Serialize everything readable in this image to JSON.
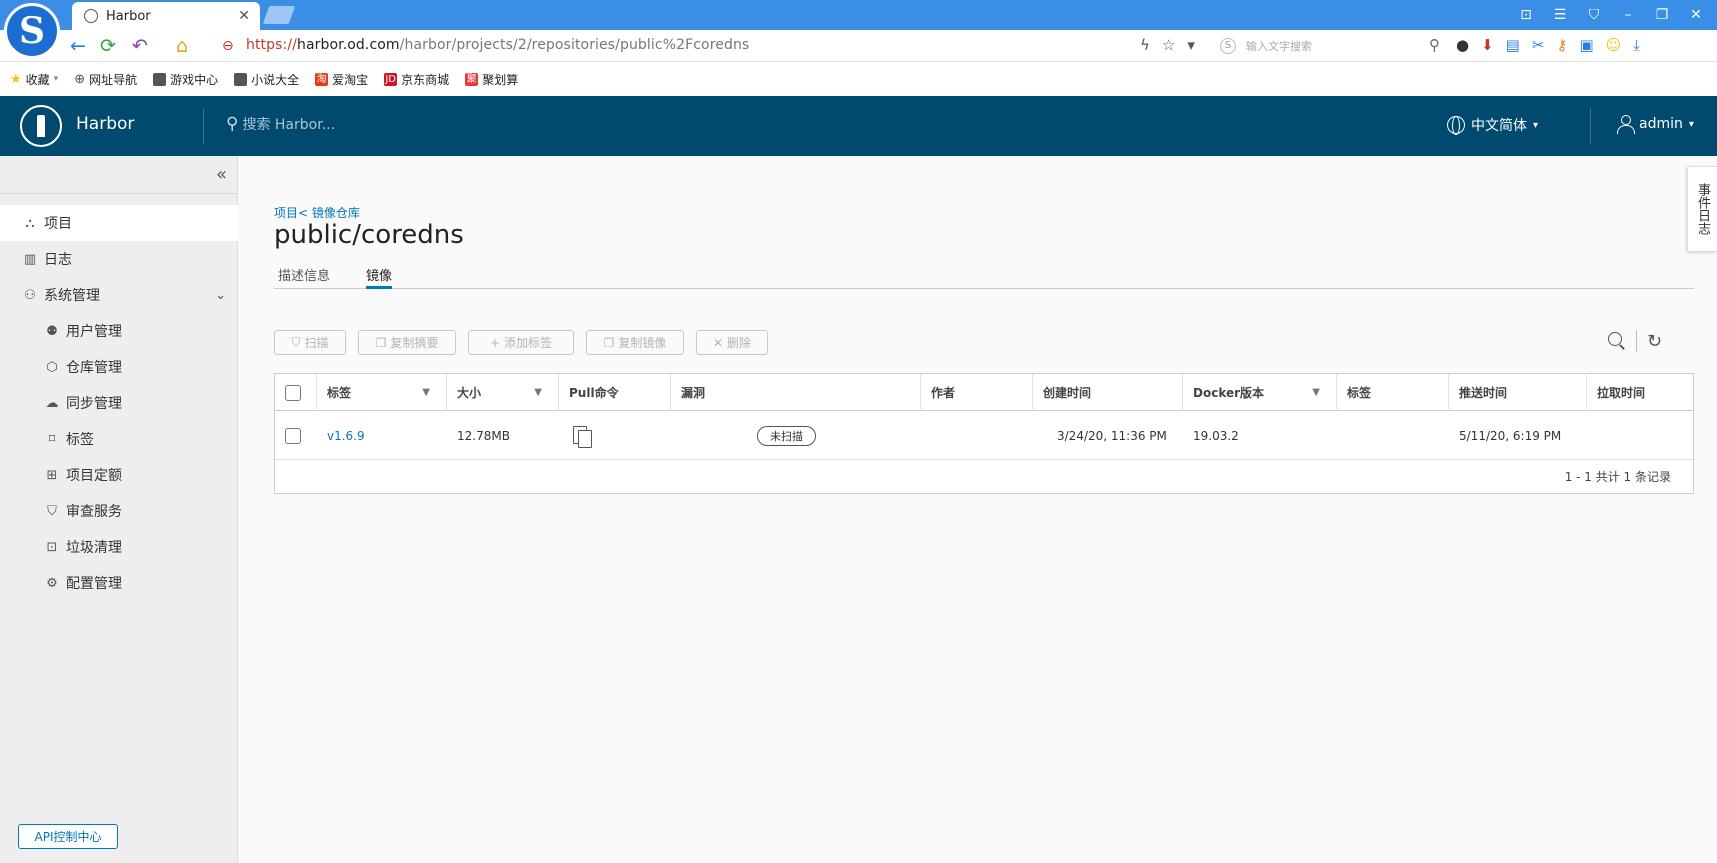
{
  "browser": {
    "tab_title": "Harbor",
    "url_proto": "https://",
    "url_host": "harbor.od.com",
    "url_path": "/harbor/projects/2/repositories/public%2Fcoredns",
    "search_placeholder": "输入文字搜索",
    "bookmarks": [
      "收藏",
      "网址导航",
      "游戏中心",
      "小说大全",
      "爱淘宝",
      "京东商城",
      "聚划算"
    ]
  },
  "header": {
    "app_name": "Harbor",
    "search_placeholder": "搜索 Harbor...",
    "language": "中文简体",
    "user": "admin"
  },
  "sidebar": {
    "items": [
      {
        "label": "项目",
        "icon": "projects-icon"
      },
      {
        "label": "日志",
        "icon": "log-icon"
      },
      {
        "label": "系统管理",
        "icon": "admin-icon"
      },
      {
        "label": "用户管理",
        "icon": "users-icon"
      },
      {
        "label": "仓库管理",
        "icon": "registry-icon"
      },
      {
        "label": "同步管理",
        "icon": "replication-icon"
      },
      {
        "label": "标签",
        "icon": "tag-icon"
      },
      {
        "label": "项目定额",
        "icon": "quota-icon"
      },
      {
        "label": "审查服务",
        "icon": "shield-icon"
      },
      {
        "label": "垃圾清理",
        "icon": "trash-icon"
      },
      {
        "label": "配置管理",
        "icon": "gear-icon"
      }
    ],
    "api_button": "API控制中心"
  },
  "main": {
    "breadcrumb": "项目< 镜像仓库",
    "title": "public/coredns",
    "tabs": [
      "描述信息",
      "镜像"
    ],
    "active_tab": "镜像",
    "toolbar": [
      "扫描",
      "复制摘要",
      "添加标签",
      "复制镜像",
      "删除"
    ],
    "columns": [
      "标签",
      "大小",
      "Pull命令",
      "漏洞",
      "作者",
      "创建时间",
      "Docker版本",
      "标签",
      "推送时间",
      "拉取时间"
    ],
    "rows": [
      {
        "tag": "v1.6.9",
        "size": "12.78MB",
        "vulnerability": "未扫描",
        "author": "",
        "created": "3/24/20, 11:36 PM",
        "docker_version": "19.03.2",
        "labels": "",
        "pushed": "5/11/20, 6:19 PM",
        "pulled": ""
      }
    ],
    "footer": "1 - 1 共计 1 条记录"
  },
  "event_tab": "事件日志",
  "colors": {
    "header_bg": "#004a70",
    "accent": "#0079b8",
    "browser_blue": "#3a8ee6"
  }
}
